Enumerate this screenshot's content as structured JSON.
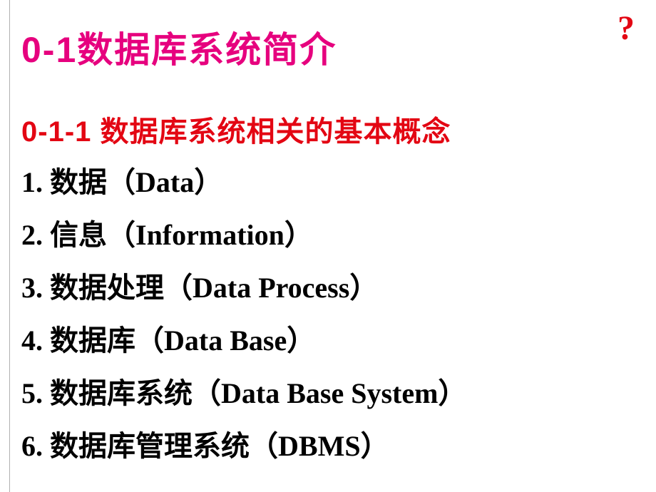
{
  "help": "?",
  "title": "0-1数据库系统简介",
  "subtitle": "0-1-1 数据库系统相关的基本概念",
  "items": [
    "1. 数据（Data）",
    "2. 信息（Information）",
    "3. 数据处理（Data Process）",
    "4. 数据库（Data Base）",
    "5. 数据库系统（Data Base System）",
    "6. 数据库管理系统（DBMS）"
  ]
}
